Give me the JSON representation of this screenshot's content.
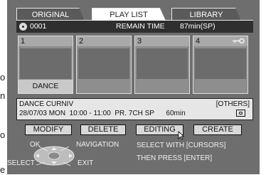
{
  "tabs": [
    {
      "label": "ORIGINAL",
      "active": false
    },
    {
      "label": "PLAY LIST",
      "active": true
    },
    {
      "label": "LIBRARY",
      "active": false
    }
  ],
  "header": {
    "disc_number": "0001",
    "remain_label": "REMAIN TIME",
    "remain_value": "87min(SP)"
  },
  "thumbnails": [
    {
      "number": "1",
      "caption": "DANCE",
      "selected": true
    },
    {
      "number": "2",
      "caption": ""
    },
    {
      "number": "3",
      "caption": ""
    },
    {
      "number": "4",
      "caption": "",
      "locked": true
    }
  ],
  "info": {
    "title": "DANCE CURNIV",
    "details": "28/07/03 MON  10:00 - 11:00  PR. 7CH SP      60min",
    "category": "[OTHERS]"
  },
  "buttons": {
    "modify": "MODIFY",
    "delete": "DELETE",
    "editing": "EDITING",
    "create": "CREATE"
  },
  "help": {
    "ok": "OK",
    "select": "SELECT",
    "navigation": "NAVIGATION",
    "exit": "EXIT",
    "line1": "SELECT WITH [CURSORS]",
    "line2": "THEN PRESS [ENTER]"
  },
  "side_letters": [
    "o",
    "n",
    "o",
    "e"
  ],
  "colors": {
    "screen_bg": "#6e6e6e",
    "header_bg": "#2f2f2f",
    "info_bg": "#e6e6e6",
    "button_bg": "#d8d8d8"
  }
}
